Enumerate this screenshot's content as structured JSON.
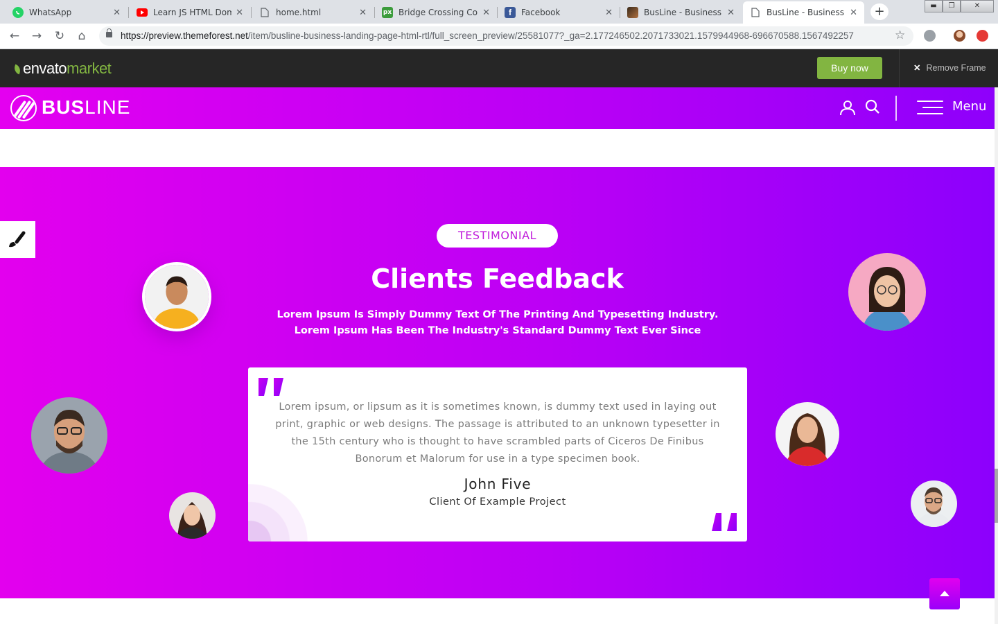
{
  "browser": {
    "tabs": [
      {
        "title": "WhatsApp",
        "icon": "whatsapp-icon"
      },
      {
        "title": "Learn JS HTML Dom",
        "icon": "youtube-icon"
      },
      {
        "title": "home.html",
        "icon": "file-icon"
      },
      {
        "title": "Bridge Crossing Cond",
        "icon": "px-icon"
      },
      {
        "title": "Facebook",
        "icon": "facebook-icon"
      },
      {
        "title": "BusLine - Business La",
        "icon": "image-icon"
      },
      {
        "title": "BusLine - Business La",
        "icon": "file-icon",
        "active": true
      }
    ],
    "url_host": "https://preview.themeforest.net",
    "url_path": "/item/busline-business-landing-page-html-rtl/full_screen_preview/25581077?_ga=2.177246502.2071733021.1579944968-696670588.1567492257"
  },
  "envato": {
    "logo_main": "envato",
    "logo_accent": "market",
    "buy_label": "Buy now",
    "remove_frame_label": "Remove Frame"
  },
  "site_header": {
    "brand_bold": "BUS",
    "brand_light": "LINE",
    "menu_label": "Menu"
  },
  "testimonial": {
    "tag": "TESTIMONIAL",
    "title": "Clients Feedback",
    "description": "Lorem Ipsum Is Simply Dummy Text Of The Printing And Typesetting Industry. Lorem Ipsum Has Been The Industry's Standard Dummy Text Ever Since",
    "quote": "Lorem ipsum, or lipsum as it is sometimes known, is dummy text used in laying out print, graphic or web designs. The passage is attributed to an unknown typesetter in the 15th century who is thought to have scrambled parts of Ciceros De Finibus Bonorum et Malorum for use in a type specimen book.",
    "client_name": "John Five",
    "client_role": "Client Of Example Project"
  },
  "colors": {
    "gradient_start": "#e300ee",
    "gradient_end": "#8c00fc",
    "envato_green": "#82b541",
    "envato_bar": "#262626"
  }
}
